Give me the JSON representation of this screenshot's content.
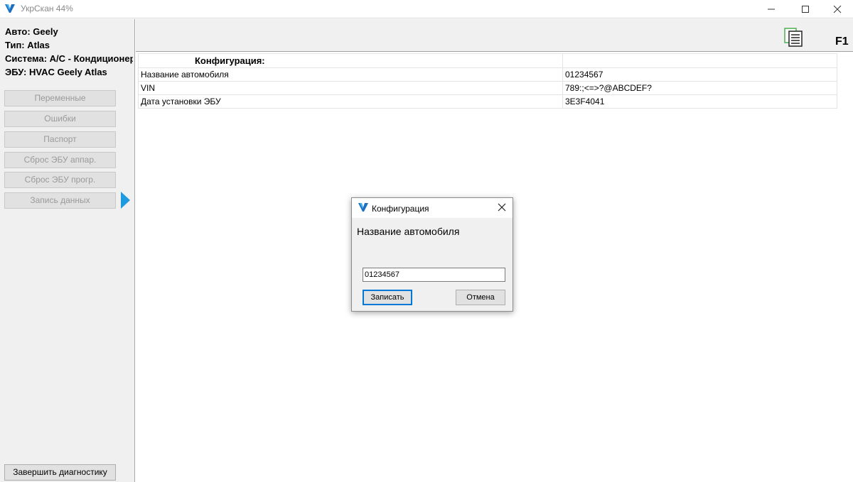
{
  "window": {
    "title": "УкрСкан 44%",
    "accent": "#1e9be0"
  },
  "sidebar": {
    "info": [
      "Авто: Geely",
      "Тип: Atlas",
      "Система: A/C - Кондиционер",
      "ЭБУ: HVAC Geely Atlas"
    ],
    "items": [
      {
        "label": "Переменные",
        "enabled": false
      },
      {
        "label": "Ошибки",
        "enabled": false
      },
      {
        "label": "Паспорт",
        "enabled": false
      },
      {
        "label": "Сброс ЭБУ аппар.",
        "enabled": false
      },
      {
        "label": "Сброс ЭБУ прогр.",
        "enabled": false
      },
      {
        "label": "Запись данных",
        "enabled": false,
        "active": true
      }
    ],
    "finish_label": "Завершить диагностику"
  },
  "toolbar": {
    "report_icon": "report-document-icon",
    "help_label": "F1"
  },
  "table": {
    "header": "Конфигурация:",
    "rows": [
      {
        "name": "Название автомобиля",
        "value": "01234567"
      },
      {
        "name": "VIN",
        "value": "789:;<=>?@ABCDEF?"
      },
      {
        "name": "Дата установки ЭБУ",
        "value": "3E3F4041"
      }
    ]
  },
  "dialog": {
    "title": "Конфигурация",
    "prompt": "Название автомобиля",
    "input_value": "01234567",
    "ok_label": "Записать",
    "cancel_label": "Отмена"
  }
}
